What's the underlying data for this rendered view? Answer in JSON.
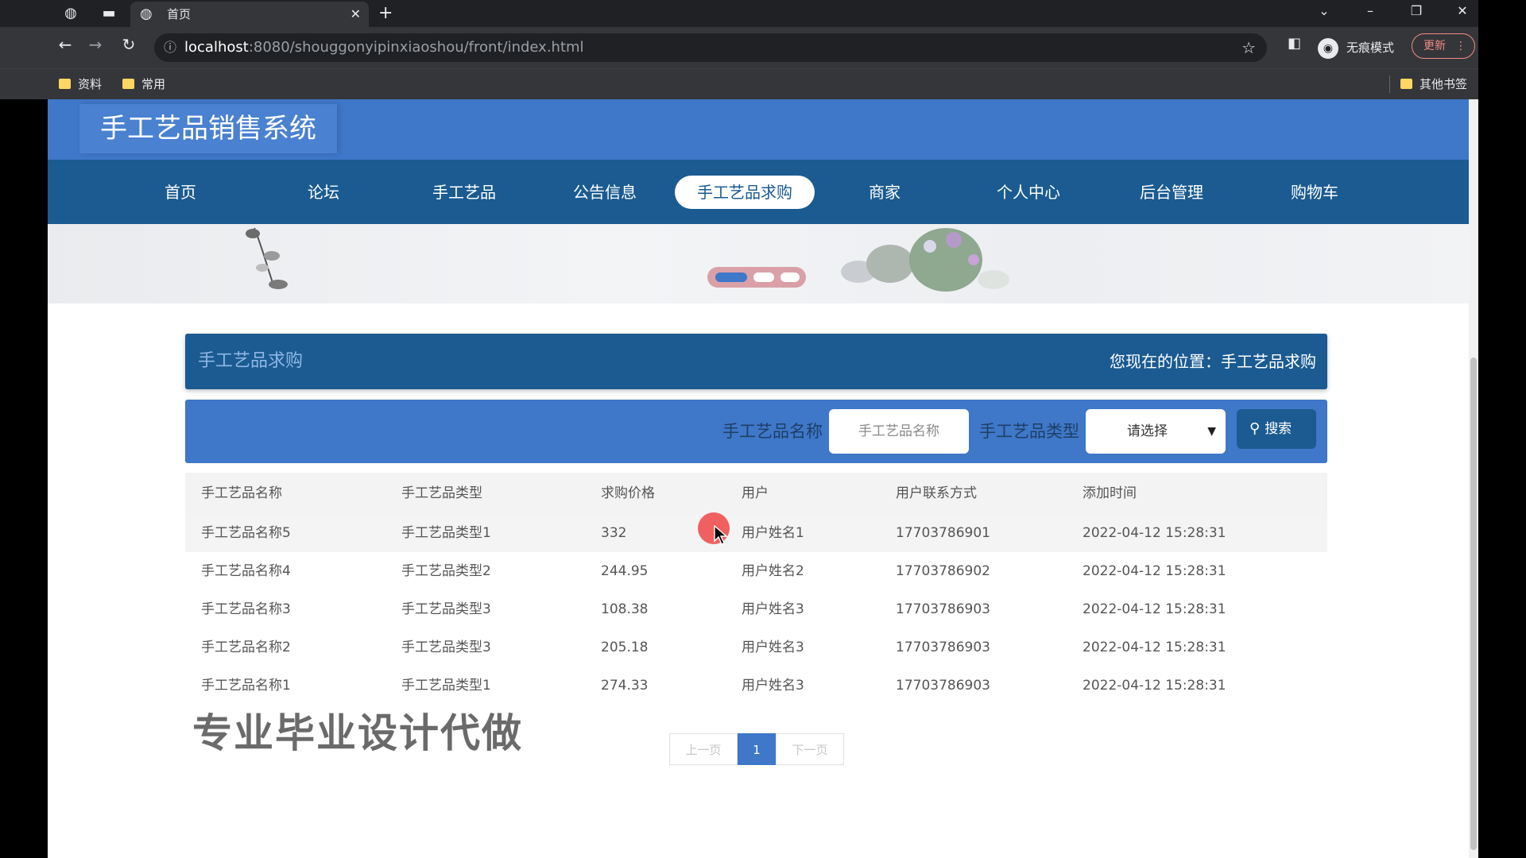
{
  "browser": {
    "tab_title": "首页",
    "url_host": "localhost",
    "url_path": ":8080/shouggonyipinxiaoshou/front/index.html",
    "incognito_label": "无痕模式",
    "update_label": "更新",
    "bookmarks": [
      "资料",
      "常用"
    ],
    "other_bookmarks": "其他书签"
  },
  "site": {
    "title": "手工艺品销售系统",
    "nav": [
      "首页",
      "论坛",
      "手工艺品",
      "公告信息",
      "手工艺品求购",
      "商家",
      "个人中心",
      "后台管理",
      "购物车"
    ],
    "active_nav_index": 4
  },
  "section": {
    "title": "手工艺品求购",
    "location": "您现在的位置：手工艺品求购"
  },
  "search": {
    "name_label": "手工艺品名称",
    "name_placeholder": "手工艺品名称",
    "type_label": "手工艺品类型",
    "type_selected": "请选择",
    "button_label": "搜索"
  },
  "table": {
    "columns": [
      "手工艺品名称",
      "手工艺品类型",
      "求购价格",
      "用户",
      "用户联系方式",
      "添加时间"
    ],
    "rows": [
      [
        "手工艺品名称5",
        "手工艺品类型1",
        "332",
        "用户姓名1",
        "17703786901",
        "2022-04-12 15:28:31"
      ],
      [
        "手工艺品名称4",
        "手工艺品类型2",
        "244.95",
        "用户姓名2",
        "17703786902",
        "2022-04-12 15:28:31"
      ],
      [
        "手工艺品名称3",
        "手工艺品类型3",
        "108.38",
        "用户姓名3",
        "17703786903",
        "2022-04-12 15:28:31"
      ],
      [
        "手工艺品名称2",
        "手工艺品类型3",
        "205.18",
        "用户姓名3",
        "17703786903",
        "2022-04-12 15:28:31"
      ],
      [
        "手工艺品名称1",
        "手工艺品类型1",
        "274.33",
        "用户姓名3",
        "17703786903",
        "2022-04-12 15:28:31"
      ]
    ]
  },
  "pagination": {
    "prev": "上一页",
    "current": "1",
    "next": "下一页"
  },
  "watermark": "专业毕业设计代做",
  "colors": {
    "header_blue": "#3f77c9",
    "nav_dark_blue": "#1b5b91",
    "cursor_highlight": "#f05050"
  }
}
